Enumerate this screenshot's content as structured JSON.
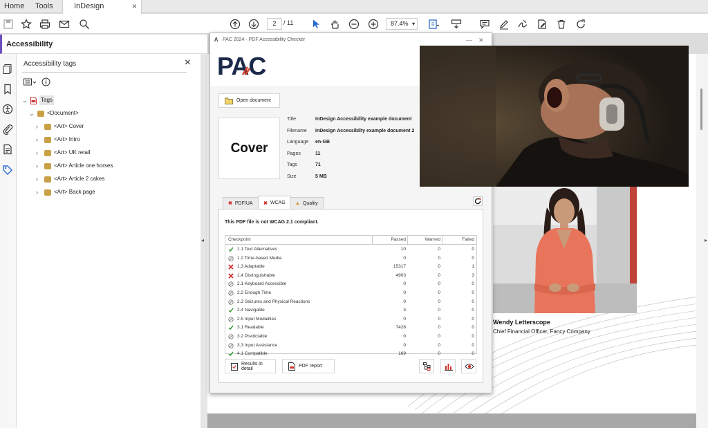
{
  "tabs": {
    "home": "Home",
    "tools": "Tools",
    "document": "InDesign Accessibili...",
    "close": "×"
  },
  "toolbar": {
    "page_current": "2",
    "page_total": "/ 11",
    "zoom": "87.4%"
  },
  "accessibility": {
    "header": "Accessibility",
    "panel_title": "Accessibility tags",
    "close": "×",
    "tree": [
      {
        "label": "Tags",
        "level": 0
      },
      {
        "label": "<Document>",
        "level": 1
      },
      {
        "label": "<Art>  Cover",
        "level": 2
      },
      {
        "label": "<Art>  Intro",
        "level": 2
      },
      {
        "label": "<Art>  UK retail",
        "level": 2
      },
      {
        "label": "<Art>  Article one horses",
        "level": 2
      },
      {
        "label": "<Art>  Article 2 cakes",
        "level": 2
      },
      {
        "label": "<Art>  Back page",
        "level": 2
      }
    ]
  },
  "pac": {
    "window_title": "PAC 2024 - PDF Accessibility Checker",
    "logo": "PAC",
    "open_document": "Open document",
    "cover_text": "Cover",
    "meta": [
      {
        "key": "Title",
        "value": "InDesign Accessibility example document"
      },
      {
        "key": "Filename",
        "value": "InDesign Accessibilty example document 2"
      },
      {
        "key": "Language",
        "value": "en-GB"
      },
      {
        "key": "Pages",
        "value": "11"
      },
      {
        "key": "Tags",
        "value": "71"
      },
      {
        "key": "Size",
        "value": "5 MB"
      }
    ],
    "tabs": [
      "PDF/UA",
      "WCAG",
      "Quality"
    ],
    "status": "This PDF file is not WCAG 2.1 compliant.",
    "columns": [
      "Checkpoint",
      "Passed",
      "Warned",
      "Failed"
    ],
    "checkpoints": [
      {
        "status": "pass",
        "name": "1.1 Text Alternatives",
        "passed": "10",
        "warned": "0",
        "failed": "0"
      },
      {
        "status": "na",
        "name": "1.2 Time-based Media",
        "passed": "0",
        "warned": "0",
        "failed": "0"
      },
      {
        "status": "fail",
        "name": "1.3 Adaptable",
        "passed": "15317",
        "warned": "0",
        "failed": "1"
      },
      {
        "status": "fail",
        "name": "1.4 Distinguishable",
        "passed": "4903",
        "warned": "0",
        "failed": "3"
      },
      {
        "status": "na",
        "name": "2.1 Keyboard Accessible",
        "passed": "0",
        "warned": "0",
        "failed": "0"
      },
      {
        "status": "na",
        "name": "2.2 Enough Time",
        "passed": "0",
        "warned": "0",
        "failed": "0"
      },
      {
        "status": "na",
        "name": "2.3 Seizures and Physical Reactions",
        "passed": "0",
        "warned": "0",
        "failed": "0"
      },
      {
        "status": "pass",
        "name": "2.4 Navigable",
        "passed": "3",
        "warned": "0",
        "failed": "0"
      },
      {
        "status": "na",
        "name": "2.5 Input Modalities",
        "passed": "0",
        "warned": "0",
        "failed": "0"
      },
      {
        "status": "pass",
        "name": "3.1 Readable",
        "passed": "7428",
        "warned": "0",
        "failed": "0"
      },
      {
        "status": "na",
        "name": "3.2 Predictable",
        "passed": "0",
        "warned": "0",
        "failed": "0"
      },
      {
        "status": "na",
        "name": "3.3 Input Assistance",
        "passed": "0",
        "warned": "0",
        "failed": "0"
      },
      {
        "status": "pass",
        "name": "4.1 Compatible",
        "passed": "169",
        "warned": "0",
        "failed": "0"
      }
    ],
    "results_detail": "Results in detail",
    "pdf_report": "PDF report"
  },
  "document": {
    "person_name": "Wendy Letterscope",
    "person_title": "Chief Financial Officer, Fancy Company"
  },
  "colors": {
    "accent": "#6a4fbf",
    "pac_navy": "#1c2a4a",
    "pac_red": "#d9412a",
    "pass": "#3a9a3a",
    "fail": "#d0312d",
    "photo_shirt": "#e8755b"
  }
}
